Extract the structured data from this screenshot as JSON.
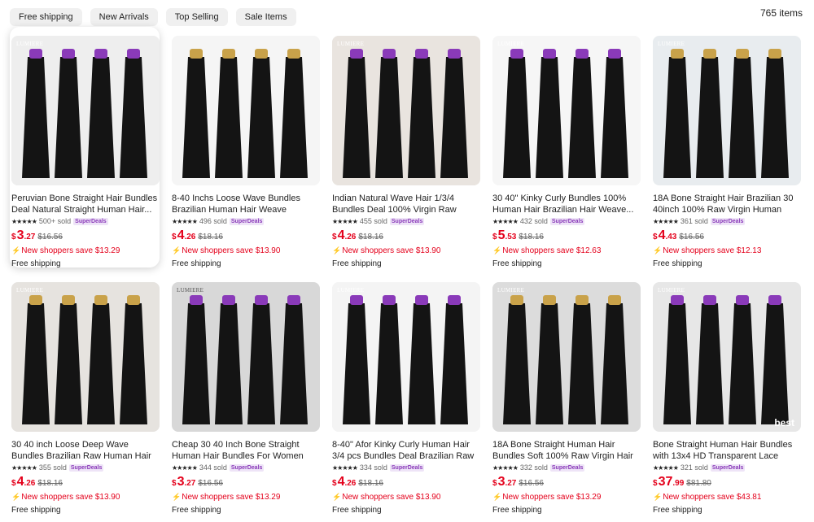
{
  "filters": [
    "Free shipping",
    "New Arrivals",
    "Top Selling",
    "Sale Items"
  ],
  "item_count": "765 items",
  "products": [
    {
      "title": "Peruvian Bone Straight Hair Bundles Deal Natural Straight Human Hair...",
      "sold": "500+ sold",
      "badge": "SuperDeals",
      "currency": "$",
      "price_int": "3",
      "price_dec": ".27",
      "original": "$16.56",
      "savings": "New shoppers save $13.29",
      "shipping": "Free shipping",
      "brand": "LUMIERE"
    },
    {
      "title": "8-40 Inchs Loose Wave Bundles Brazilian Human Hair Weave Bundles...",
      "sold": "496 sold",
      "badge": "SuperDeals",
      "currency": "$",
      "price_int": "4",
      "price_dec": ".26",
      "original": "$18.16",
      "savings": "New shoppers save $13.90",
      "shipping": "Free shipping",
      "brand": ""
    },
    {
      "title": "Indian Natural Wave Hair 1/3/4 Bundles Deal 100% Virgin Raw Human Hair...",
      "sold": "455 sold",
      "badge": "SuperDeals",
      "currency": "$",
      "price_int": "4",
      "price_dec": ".26",
      "original": "$18.16",
      "savings": "New shoppers save $13.90",
      "shipping": "Free shipping",
      "brand": "LUMIERE"
    },
    {
      "title": "30 40\" Kinky Curly Bundles 100% Human Hair Brazilian Hair Weave...",
      "sold": "432 sold",
      "badge": "SuperDeals",
      "currency": "$",
      "price_int": "5",
      "price_dec": ".53",
      "original": "$18.16",
      "savings": "New shoppers save $12.63",
      "shipping": "Free shipping",
      "brand": "LUMIERE"
    },
    {
      "title": "18A Bone Straight Hair Brazilian 30 40inch 100% Raw Virgin Human Hair...",
      "sold": "361 sold",
      "badge": "SuperDeals",
      "currency": "$",
      "price_int": "4",
      "price_dec": ".43",
      "original": "$16.56",
      "savings": "New shoppers save $12.13",
      "shipping": "Free shipping",
      "brand": "LUMIERE"
    },
    {
      "title": "30 40 inch Loose Deep Wave Bundles Brazilian Raw Human Hair Weave...",
      "sold": "355 sold",
      "badge": "SuperDeals",
      "currency": "$",
      "price_int": "4",
      "price_dec": ".26",
      "original": "$18.16",
      "savings": "New shoppers save $13.90",
      "shipping": "Free shipping",
      "brand": "LUMIERE"
    },
    {
      "title": "Cheap 30 40 Inch Bone Straight Human Hair Bundles For Women Raw...",
      "sold": "344 sold",
      "badge": "SuperDeals",
      "currency": "$",
      "price_int": "3",
      "price_dec": ".27",
      "original": "$16.56",
      "savings": "New shoppers save $13.29",
      "shipping": "Free shipping",
      "brand": "LUMIERE"
    },
    {
      "title": "8-40\" Afor Kinky Curly Human Hair 3/4 pcs Bundles Deal Brazilian Raw Hair...",
      "sold": "334 sold",
      "badge": "SuperDeals",
      "currency": "$",
      "price_int": "4",
      "price_dec": ".26",
      "original": "$18.16",
      "savings": "New shoppers save $13.90",
      "shipping": "Free shipping",
      "brand": "LUMIERE"
    },
    {
      "title": "18A Bone Straight Human Hair Bundles Soft 100% Raw Virgin Hair Extension...",
      "sold": "332 sold",
      "badge": "SuperDeals",
      "currency": "$",
      "price_int": "3",
      "price_dec": ".27",
      "original": "$16.56",
      "savings": "New shoppers save $13.29",
      "shipping": "Free shipping",
      "brand": "LUMIERE"
    },
    {
      "title": "Bone Straight Human Hair Bundles with 13x4 HD Transparent Lace Frontal...",
      "sold": "321 sold",
      "badge": "SuperDeals",
      "currency": "$",
      "price_int": "37",
      "price_dec": ".99",
      "original": "$81.80",
      "savings": "New shoppers save $43.81",
      "shipping": "Free shipping",
      "brand": "LUMIERE",
      "overlay": "best"
    }
  ],
  "colors": {
    "price_red": "#e4001b",
    "badge_purple": "#8a3ab9",
    "chip_bg": "#f0f0f0"
  }
}
